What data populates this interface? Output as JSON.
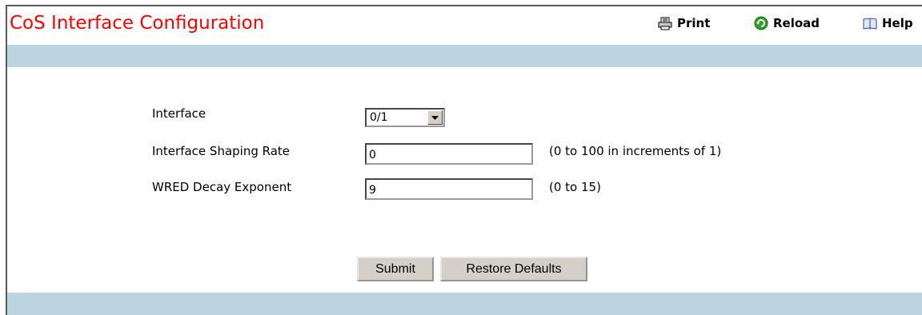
{
  "header": {
    "title": "CoS Interface Configuration",
    "print_label": "Print",
    "reload_label": "Reload",
    "help_label": "Help"
  },
  "form": {
    "interface": {
      "label": "Interface",
      "value": "0/1"
    },
    "shaping_rate": {
      "label": "Interface Shaping Rate",
      "value": "0",
      "hint": "(0 to 100 in increments of 1)"
    },
    "wred_decay": {
      "label": "WRED Decay Exponent",
      "value": "9",
      "hint": "(0 to 15)"
    }
  },
  "buttons": {
    "submit_label": "Submit",
    "restore_label": "Restore Defaults"
  },
  "colors": {
    "title": "#ff0000",
    "band": "#bcd3e0",
    "reload_icon": "#2aa12a",
    "button_face": "#d4d0c8"
  },
  "icons": {
    "print": "printer-icon",
    "reload": "reload-icon",
    "help": "book-icon",
    "dropdown": "chevron-down-icon"
  }
}
